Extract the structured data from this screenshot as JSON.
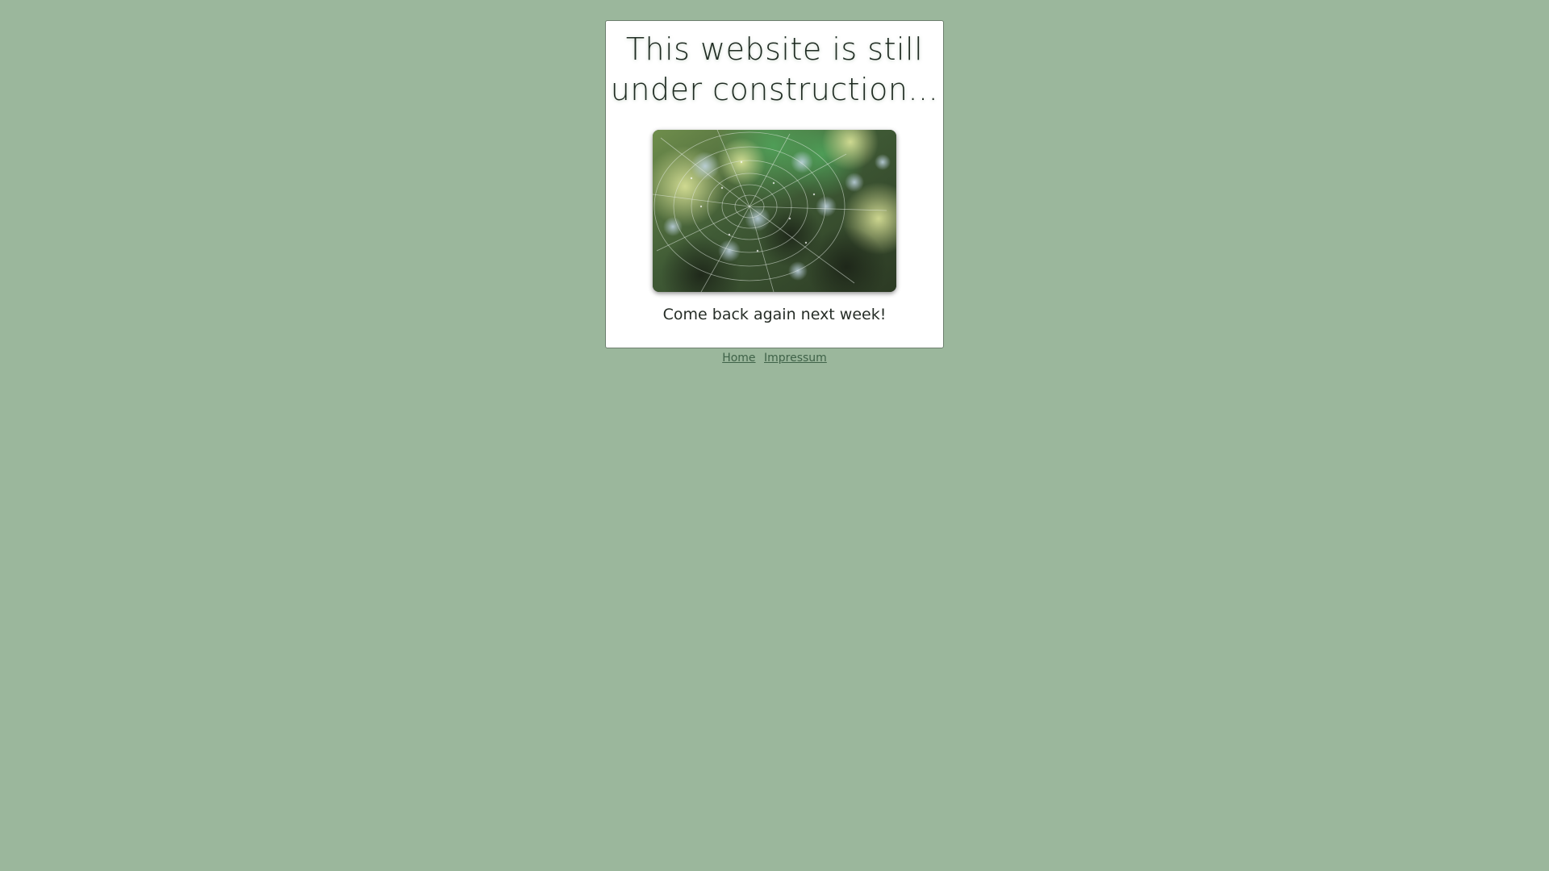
{
  "page": {
    "background_color": "#9bb79c"
  },
  "card": {
    "headline": "This website is still under construction...",
    "image": {
      "subject": "spider web with dew drops",
      "icon": "spider-web-photo"
    },
    "message": "Come back again next week!"
  },
  "footer": {
    "links": [
      {
        "label": "Home"
      },
      {
        "label": "Impressum"
      }
    ],
    "link_color": "#3f6248"
  }
}
